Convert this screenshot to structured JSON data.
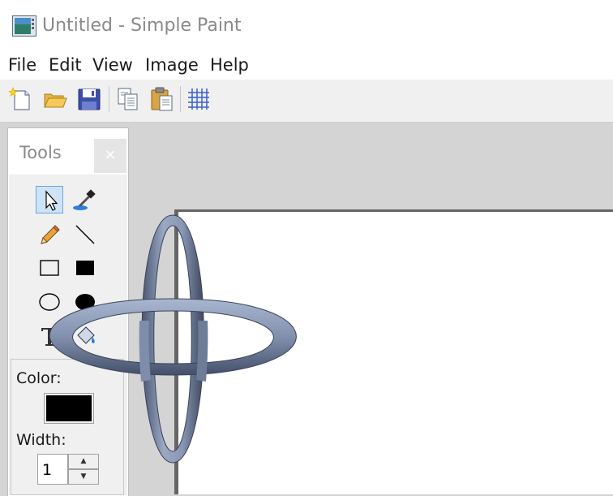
{
  "window": {
    "title": "Untitled - Simple Paint"
  },
  "menu": [
    "File",
    "Edit",
    "View",
    "Image",
    "Help"
  ],
  "toolbar": {
    "buttons": [
      "new-icon",
      "open-icon",
      "save-icon",
      "copy-icon",
      "paste-icon",
      "grid-icon"
    ]
  },
  "tools_panel": {
    "title": "Tools",
    "close_glyph": "×",
    "tools": [
      "select-tool",
      "eyedropper-tool",
      "pencil-tool",
      "line-tool",
      "rectangle-tool",
      "filled-rectangle-tool",
      "ellipse-tool",
      "filled-ellipse-tool",
      "text-tool",
      "fill-tool"
    ],
    "selected_tool": "select-tool",
    "color_label": "Color:",
    "color_value": "#000000",
    "width_label": "Width:",
    "width_value": "1"
  },
  "colors": {
    "accent": "#6aa5dc",
    "canvas": "#ffffff",
    "workspace": "#d4d4d4"
  }
}
